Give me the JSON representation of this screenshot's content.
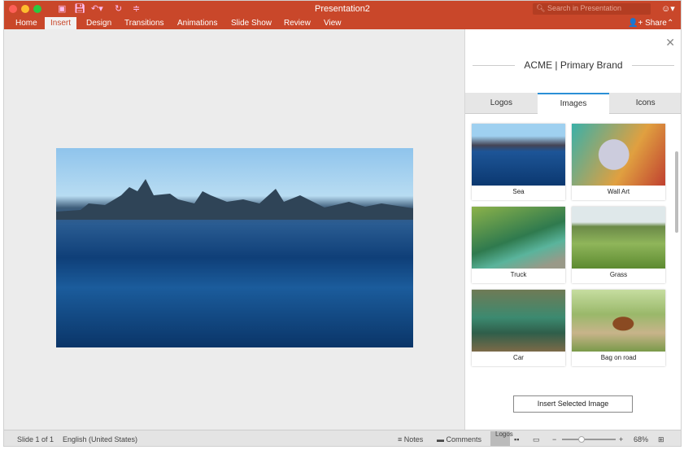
{
  "window": {
    "title": "Presentation2",
    "search_placeholder": "Search in Presentation",
    "share": "Share"
  },
  "ribbon": {
    "tabs": [
      "Home",
      "Insert",
      "Design",
      "Transitions",
      "Animations",
      "Slide Show",
      "Review",
      "View"
    ],
    "active": "Insert"
  },
  "panel": {
    "brand": "ACME | Primary Brand",
    "tabs": [
      "Logos",
      "Images",
      "Icons"
    ],
    "active_tab": "Images",
    "images": [
      "Sea",
      "Wall Art",
      "Truck",
      "Grass",
      "Car",
      "Bag on road"
    ],
    "insert_button": "Insert Selected Image"
  },
  "status": {
    "slide": "Slide 1 of 1",
    "language": "English (United States)",
    "notes": "Notes",
    "comments": "Comments",
    "zoom": "68%",
    "overlay": "Logos"
  },
  "colors": {
    "accent": "#c9472a",
    "tab_active": "#2b8fd6"
  }
}
